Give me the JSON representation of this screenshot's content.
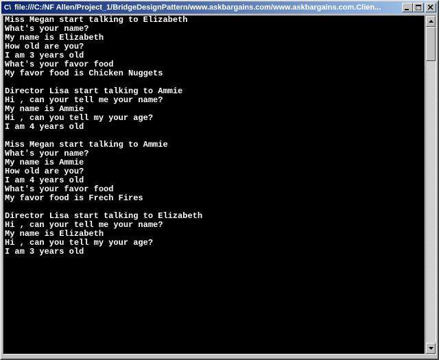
{
  "titlebar": {
    "icon_glyph": "C\\",
    "title": "file:///C:/NF Allen/Project_1/BridgeDesignPattern/www.askbargains.com/www.askbargains.com.Clien..."
  },
  "console": {
    "blocks": [
      [
        "Miss Megan start talking to Elizabeth",
        "What's your name?",
        "My name is Elizabeth",
        "How old are you?",
        "I am 3 years old",
        "What's your favor food",
        "My favor food is Chicken Nuggets"
      ],
      [
        "Director Lisa start talking to Ammie",
        "Hi , can your tell me your name?",
        "My name is Ammie",
        "Hi , can you tell my your age?",
        "I am 4 years old"
      ],
      [
        "Miss Megan start talking to Ammie",
        "What's your name?",
        "My name is Ammie",
        "How old are you?",
        "I am 4 years old",
        "What's your favor food",
        "My favor food is Frech Fires"
      ],
      [
        "Director Lisa start talking to Elizabeth",
        "Hi , can your tell me your name?",
        "My name is Elizabeth",
        "Hi , can you tell my your age?",
        "I am 3 years old"
      ]
    ]
  }
}
